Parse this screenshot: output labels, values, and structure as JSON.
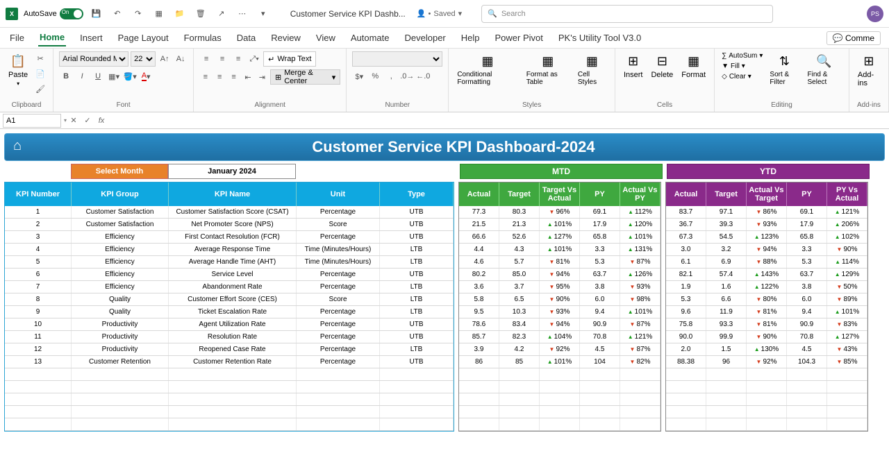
{
  "titlebar": {
    "autosave": "AutoSave",
    "autosave_on": "On",
    "doc_title": "Customer Service KPI Dashb...",
    "saved": "Saved",
    "search_placeholder": "Search",
    "avatar": "PS"
  },
  "tabs": [
    "File",
    "Home",
    "Insert",
    "Page Layout",
    "Formulas",
    "Data",
    "Review",
    "View",
    "Automate",
    "Developer",
    "Help",
    "Power Pivot",
    "PK's Utility Tool V3.0"
  ],
  "comments_label": "Comme",
  "ribbon": {
    "paste": "Paste",
    "clipboard": "Clipboard",
    "font_name": "Arial Rounded MT",
    "font_size": "22",
    "font": "Font",
    "wrap": "Wrap Text",
    "merge": "Merge & Center",
    "alignment": "Alignment",
    "number": "Number",
    "cond_fmt": "Conditional Formatting",
    "fmt_table": "Format as Table",
    "cell_styles": "Cell Styles",
    "styles": "Styles",
    "insert": "Insert",
    "delete": "Delete",
    "format": "Format",
    "cells": "Cells",
    "autosum": "AutoSum",
    "fill": "Fill",
    "clear": "Clear",
    "sort": "Sort & Filter",
    "find": "Find & Select",
    "editing": "Editing",
    "addins": "Add-ins",
    "addins_grp": "Add-ins"
  },
  "formula": {
    "cell_ref": "A1"
  },
  "dashboard": {
    "title": "Customer Service KPI Dashboard-2024",
    "select_month": "Select Month",
    "month": "January 2024",
    "mtd": "MTD",
    "ytd": "YTD"
  },
  "kpi_headers": [
    "KPI Number",
    "KPI Group",
    "KPI Name",
    "Unit",
    "Type"
  ],
  "metric_headers": [
    "Actual",
    "Target",
    "Target Vs Actual",
    "PY",
    "Actual Vs PY"
  ],
  "ytd_headers": [
    "Actual",
    "Target",
    "Actual Vs Target",
    "PY",
    "PY Vs Actual"
  ],
  "rows": [
    {
      "num": "1",
      "grp": "Customer Satisfaction",
      "name": "Customer Satisfaction Score (CSAT)",
      "unit": "Percentage",
      "type": "UTB",
      "mtd": {
        "a": "77.3",
        "t": "80.3",
        "tva": "96%",
        "tvad": "d",
        "py": "69.1",
        "avp": "112%",
        "avpd": "u"
      },
      "ytd": {
        "a": "83.7",
        "t": "97.1",
        "avt": "86%",
        "avtd": "d",
        "py": "69.1",
        "pva": "121%",
        "pvad": "u"
      }
    },
    {
      "num": "2",
      "grp": "Customer Satisfaction",
      "name": "Net Promoter Score (NPS)",
      "unit": "Score",
      "type": "UTB",
      "mtd": {
        "a": "21.5",
        "t": "21.3",
        "tva": "101%",
        "tvad": "u",
        "py": "17.9",
        "avp": "120%",
        "avpd": "u"
      },
      "ytd": {
        "a": "36.7",
        "t": "39.3",
        "avt": "93%",
        "avtd": "d",
        "py": "17.9",
        "pva": "206%",
        "pvad": "u"
      }
    },
    {
      "num": "3",
      "grp": "Efficiency",
      "name": "First Contact Resolution (FCR)",
      "unit": "Percentage",
      "type": "UTB",
      "mtd": {
        "a": "66.6",
        "t": "52.6",
        "tva": "127%",
        "tvad": "u",
        "py": "65.8",
        "avp": "101%",
        "avpd": "u"
      },
      "ytd": {
        "a": "67.3",
        "t": "54.5",
        "avt": "123%",
        "avtd": "u",
        "py": "65.8",
        "pva": "102%",
        "pvad": "u"
      }
    },
    {
      "num": "4",
      "grp": "Efficiency",
      "name": "Average Response Time",
      "unit": "Time (Minutes/Hours)",
      "type": "LTB",
      "mtd": {
        "a": "4.4",
        "t": "4.3",
        "tva": "101%",
        "tvad": "u",
        "py": "3.3",
        "avp": "131%",
        "avpd": "u"
      },
      "ytd": {
        "a": "3.0",
        "t": "3.2",
        "avt": "94%",
        "avtd": "d",
        "py": "3.3",
        "pva": "90%",
        "pvad": "d"
      }
    },
    {
      "num": "5",
      "grp": "Efficiency",
      "name": "Average Handle Time (AHT)",
      "unit": "Time (Minutes/Hours)",
      "type": "LTB",
      "mtd": {
        "a": "4.6",
        "t": "5.7",
        "tva": "81%",
        "tvad": "d",
        "py": "5.3",
        "avp": "87%",
        "avpd": "d"
      },
      "ytd": {
        "a": "6.1",
        "t": "6.9",
        "avt": "88%",
        "avtd": "d",
        "py": "5.3",
        "pva": "114%",
        "pvad": "u"
      }
    },
    {
      "num": "6",
      "grp": "Efficiency",
      "name": "Service Level",
      "unit": "Percentage",
      "type": "UTB",
      "mtd": {
        "a": "80.2",
        "t": "85.0",
        "tva": "94%",
        "tvad": "d",
        "py": "63.7",
        "avp": "126%",
        "avpd": "u"
      },
      "ytd": {
        "a": "82.1",
        "t": "57.4",
        "avt": "143%",
        "avtd": "u",
        "py": "63.7",
        "pva": "129%",
        "pvad": "u"
      }
    },
    {
      "num": "7",
      "grp": "Efficiency",
      "name": "Abandonment Rate",
      "unit": "Percentage",
      "type": "LTB",
      "mtd": {
        "a": "3.6",
        "t": "3.7",
        "tva": "95%",
        "tvad": "d",
        "py": "3.8",
        "avp": "93%",
        "avpd": "d"
      },
      "ytd": {
        "a": "1.9",
        "t": "1.6",
        "avt": "122%",
        "avtd": "u",
        "py": "3.8",
        "pva": "50%",
        "pvad": "d"
      }
    },
    {
      "num": "8",
      "grp": "Quality",
      "name": "Customer Effort Score (CES)",
      "unit": "Score",
      "type": "LTB",
      "mtd": {
        "a": "5.8",
        "t": "6.5",
        "tva": "90%",
        "tvad": "d",
        "py": "6.0",
        "avp": "98%",
        "avpd": "d"
      },
      "ytd": {
        "a": "5.3",
        "t": "6.6",
        "avt": "80%",
        "avtd": "d",
        "py": "6.0",
        "pva": "89%",
        "pvad": "d"
      }
    },
    {
      "num": "9",
      "grp": "Quality",
      "name": "Ticket Escalation Rate",
      "unit": "Percentage",
      "type": "LTB",
      "mtd": {
        "a": "9.5",
        "t": "10.3",
        "tva": "93%",
        "tvad": "d",
        "py": "9.4",
        "avp": "101%",
        "avpd": "u"
      },
      "ytd": {
        "a": "9.6",
        "t": "11.9",
        "avt": "81%",
        "avtd": "d",
        "py": "9.4",
        "pva": "101%",
        "pvad": "u"
      }
    },
    {
      "num": "10",
      "grp": "Productivity",
      "name": "Agent Utilization Rate",
      "unit": "Percentage",
      "type": "UTB",
      "mtd": {
        "a": "78.6",
        "t": "83.4",
        "tva": "94%",
        "tvad": "d",
        "py": "90.9",
        "avp": "87%",
        "avpd": "d"
      },
      "ytd": {
        "a": "75.8",
        "t": "93.3",
        "avt": "81%",
        "avtd": "d",
        "py": "90.9",
        "pva": "83%",
        "pvad": "d"
      }
    },
    {
      "num": "11",
      "grp": "Productivity",
      "name": "Resolution Rate",
      "unit": "Percentage",
      "type": "UTB",
      "mtd": {
        "a": "85.7",
        "t": "82.3",
        "tva": "104%",
        "tvad": "u",
        "py": "70.8",
        "avp": "121%",
        "avpd": "u"
      },
      "ytd": {
        "a": "90.0",
        "t": "99.9",
        "avt": "90%",
        "avtd": "d",
        "py": "70.8",
        "pva": "127%",
        "pvad": "u"
      }
    },
    {
      "num": "12",
      "grp": "Productivity",
      "name": "Reopened Case Rate",
      "unit": "Percentage",
      "type": "LTB",
      "mtd": {
        "a": "3.9",
        "t": "4.2",
        "tva": "92%",
        "tvad": "d",
        "py": "4.5",
        "avp": "87%",
        "avpd": "d"
      },
      "ytd": {
        "a": "2.0",
        "t": "1.5",
        "avt": "130%",
        "avtd": "u",
        "py": "4.5",
        "pva": "43%",
        "pvad": "d"
      }
    },
    {
      "num": "13",
      "grp": "Customer Retention",
      "name": "Customer Retention Rate",
      "unit": "Percentage",
      "type": "UTB",
      "mtd": {
        "a": "86",
        "t": "85",
        "tva": "101%",
        "tvad": "u",
        "py": "104",
        "avp": "82%",
        "avpd": "d"
      },
      "ytd": {
        "a": "88.38",
        "t": "96",
        "avt": "92%",
        "avtd": "d",
        "py": "104.3",
        "pva": "85%",
        "pvad": "d"
      }
    }
  ]
}
